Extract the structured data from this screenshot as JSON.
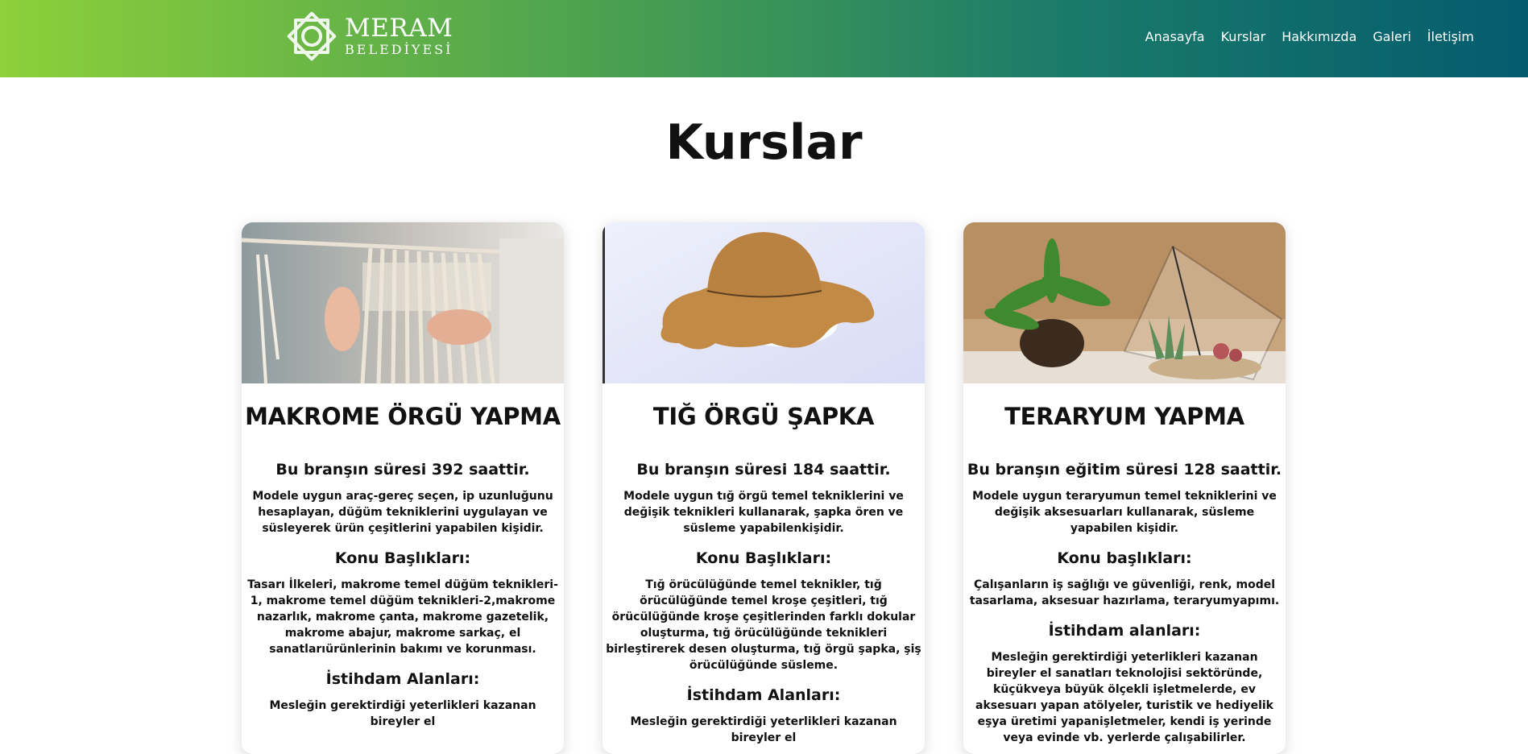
{
  "brand": {
    "line1": "MERAM",
    "line2": "BELEDİYESİ"
  },
  "nav": [
    "Anasayfa",
    "Kurslar",
    "Hakkımızda",
    "Galeri",
    "İletişim"
  ],
  "page_title": "Kurslar",
  "colors": {
    "header_start": "#8dd03a",
    "header_end": "#035c6e"
  },
  "cards": [
    {
      "title": "MAKROME ÖRGÜ YAPMA",
      "duration": "Bu branşın süresi 392 saattir.",
      "description": "Modele uygun araç-gereç seçen, ip uzunluğunu hesaplayan, düğüm tekniklerini uygulayan ve süsleyerek ürün çeşitlerini yapabilen kişidir.",
      "topics_heading": "Konu Başlıkları:",
      "topics": "Tasarı İlkeleri, makrome temel düğüm teknikleri-1, makrome temel düğüm teknikleri-2,makrome nazarlık, makrome çanta, makrome gazetelik, makrome abajur, makrome sarkaç, el sanatlarıürünlerinin bakımı ve korunması.",
      "employment_heading": "İstihdam Alanları:",
      "employment": "Mesleğin gerektirdiği yeterlikleri kazanan bireyler el"
    },
    {
      "title": "TIĞ ÖRGÜ ŞAPKA",
      "duration": "Bu branşın süresi 184 saattir.",
      "description": "Modele uygun tığ örgü temel tekniklerini ve değişik teknikleri kullanarak, şapka ören ve süsleme yapabilenkişidir.",
      "topics_heading": "Konu Başlıkları:",
      "topics": "Tığ örücülüğünde temel teknikler, tığ örücülüğünde temel kroşe çeşitleri, tığ örücülüğünde kroşe çeşitlerinden farklı dokular oluşturma, tığ örücülüğünde teknikleri birleştirerek desen oluşturma, tığ örgü şapka, şiş örücülüğünde süsleme.",
      "employment_heading": "İstihdam Alanları:",
      "employment": "Mesleğin gerektirdiği yeterlikleri kazanan bireyler el"
    },
    {
      "title": "TERARYUM YAPMA",
      "duration": "Bu branşın eğitim süresi 128 saattir.",
      "description": "Modele uygun teraryumun temel tekniklerini ve değişik aksesuarları kullanarak, süsleme yapabilen kişidir.",
      "topics_heading": "Konu başlıkları:",
      "topics": "Çalışanların iş sağlığı ve güvenliği, renk, model tasarlama, aksesuar hazırlama, teraryumyapımı.",
      "employment_heading": "İstihdam alanları:",
      "employment": "Mesleğin gerektirdiği yeterlikleri kazanan bireyler el sanatları teknolojisi sektöründe, küçükveya büyük ölçekli işletmelerde, ev aksesuarı yapan atölyeler, turistik ve hediyelik eşya üretimi yapanişletmeler, kendi iş yerinde veya evinde vb. yerlerde çalışabilirler."
    }
  ]
}
